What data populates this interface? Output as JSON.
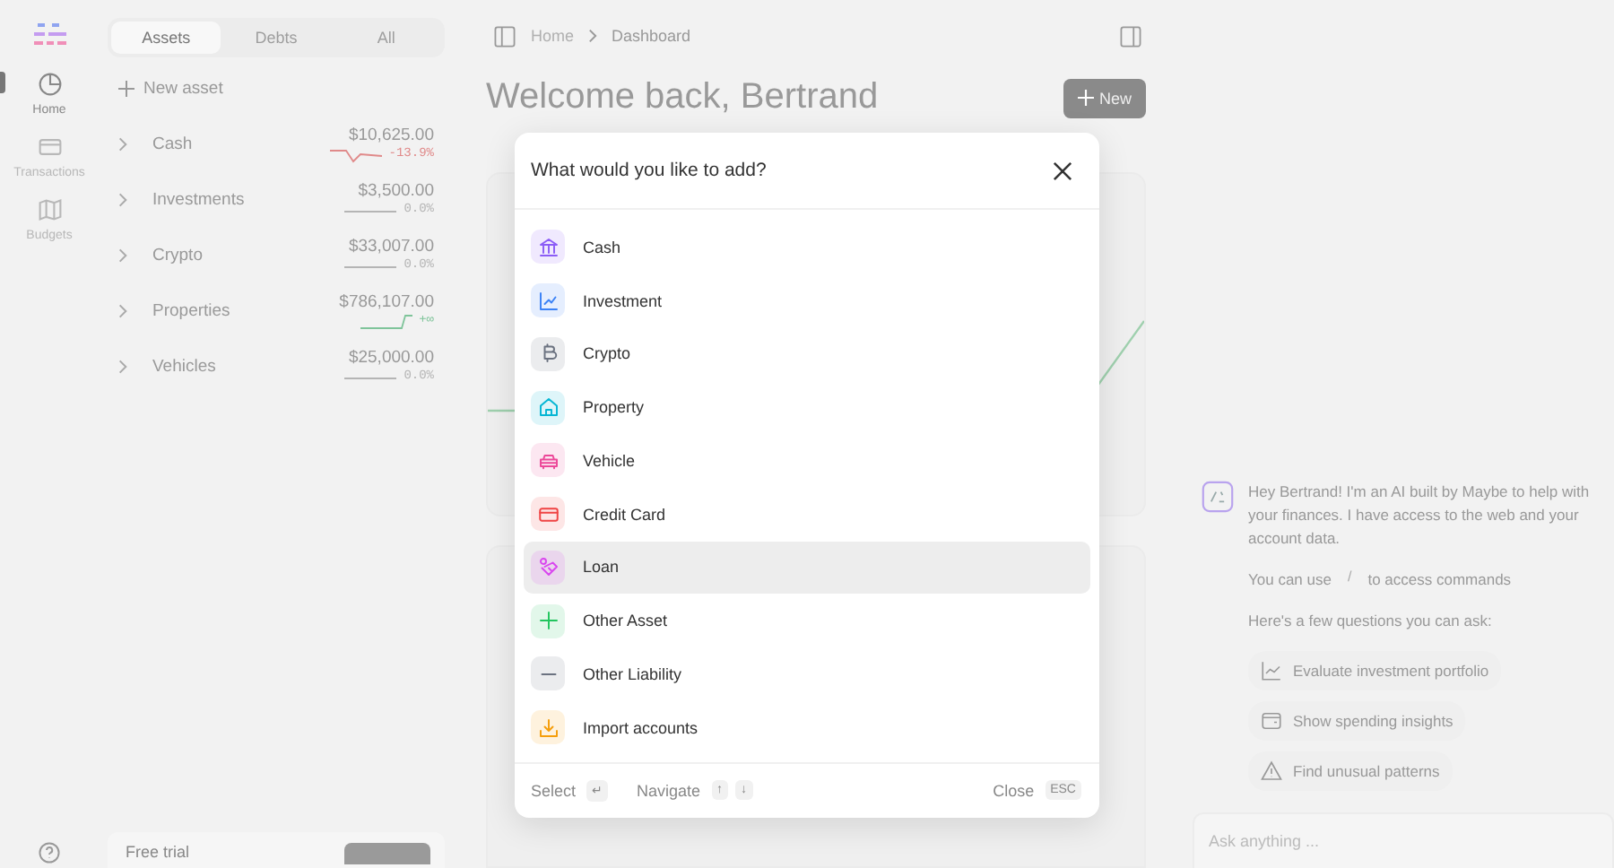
{
  "nav": [
    {
      "label": "Home",
      "kind": "pie",
      "selected": true
    },
    {
      "label": "Transactions",
      "kind": "card",
      "selected": false
    },
    {
      "label": "Budgets",
      "kind": "map",
      "selected": false
    }
  ],
  "sidebar": {
    "tabs": [
      {
        "label": "Assets",
        "selected": true
      },
      {
        "label": "Debts",
        "selected": false
      },
      {
        "label": "All",
        "selected": false
      }
    ],
    "new_asset": "New asset",
    "accounts": [
      {
        "name": "Cash",
        "value": "$10,625.00",
        "change": "-13.9%",
        "kind": "down"
      },
      {
        "name": "Investments",
        "value": "$3,500.00",
        "change": "0.0%",
        "kind": "flat"
      },
      {
        "name": "Crypto",
        "value": "$33,007.00",
        "change": "0.0%",
        "kind": "flat"
      },
      {
        "name": "Properties",
        "value": "$786,107.00",
        "change": "+∞",
        "kind": "up"
      },
      {
        "name": "Vehicles",
        "value": "$25,000.00",
        "change": "0.0%",
        "kind": "flat"
      }
    ],
    "trial": {
      "label": "Free trial"
    }
  },
  "breadcrumb": [
    "Home",
    "Dashboard"
  ],
  "title": "Welcome back, Bertrand",
  "new_button": "New",
  "modal": {
    "title": "What would you like to add?",
    "items": [
      {
        "label": "Cash",
        "kind": "bank",
        "color": "#8b5cf6",
        "selected": false
      },
      {
        "label": "Investment",
        "kind": "chart",
        "color": "#3b82f6",
        "selected": false
      },
      {
        "label": "Crypto",
        "kind": "coin",
        "color": "#6b7280",
        "selected": false
      },
      {
        "label": "Property",
        "kind": "house",
        "color": "#06b6d4",
        "selected": false
      },
      {
        "label": "Vehicle",
        "kind": "car",
        "color": "#ec4899",
        "selected": false
      },
      {
        "label": "Credit Card",
        "kind": "card",
        "color": "#ef4444",
        "selected": false
      },
      {
        "label": "Loan",
        "kind": "loan",
        "color": "#d946ef",
        "selected": true
      },
      {
        "label": "Other Asset",
        "kind": "plus",
        "color": "#22c55e",
        "selected": false
      },
      {
        "label": "Other Liability",
        "kind": "minus",
        "color": "#6b7280",
        "selected": false
      },
      {
        "label": "Import accounts",
        "kind": "import",
        "color": "#f59e0b",
        "selected": false
      }
    ],
    "footer": {
      "select": "Select",
      "select_key": "↵",
      "navigate": "Navigate",
      "navigate_keys": [
        "↑",
        "↓"
      ],
      "close": "Close",
      "close_key": "ESC"
    }
  },
  "chat": {
    "message": "Hey Bertrand! I'm an AI built by Maybe to help with your finances. I have access to the web and your account data.",
    "commands_before": "You can use",
    "commands_key": "/",
    "commands_after": "to access commands",
    "prompt": "Here's a few questions you can ask:",
    "suggestions": [
      {
        "label": "Evaluate investment portfolio",
        "kind": "chart"
      },
      {
        "label": "Show spending insights",
        "kind": "wallet"
      },
      {
        "label": "Find unusual patterns",
        "kind": "warning"
      }
    ],
    "input": {
      "placeholder": "Ask anything ..."
    }
  }
}
